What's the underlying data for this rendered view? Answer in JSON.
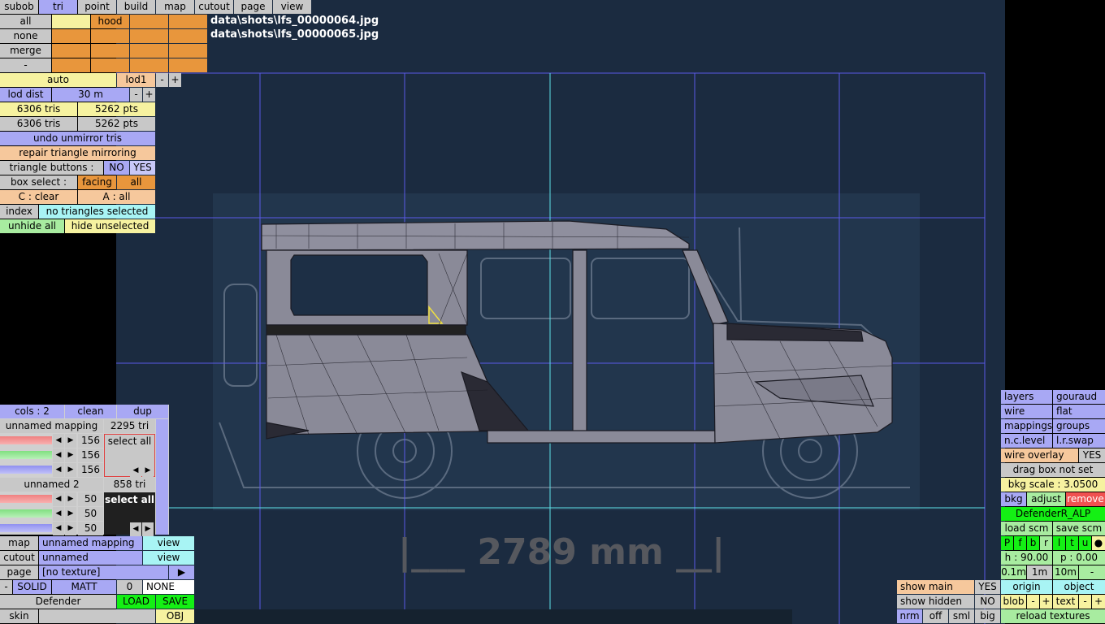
{
  "topbar": {
    "tabs": [
      "subob",
      "tri",
      "point",
      "build",
      "map",
      "cutout",
      "page",
      "view"
    ],
    "active": "tri"
  },
  "subob": {
    "all": "all",
    "none": "none",
    "merge": "merge",
    "minus": "-",
    "hood": "hood"
  },
  "screenshots": [
    "data\\shots\\lfs_00000064.jpg",
    "data\\shots\\lfs_00000065.jpg"
  ],
  "lod": {
    "auto": "auto",
    "lod1": "lod1",
    "minus": "-",
    "plus": "+",
    "dist_label": "lod dist",
    "dist_value": "30 m",
    "dist_minus": "-",
    "dist_plus": "+"
  },
  "counts": {
    "tris1": "6306 tris",
    "pts1": "5262 pts",
    "tris2": "6306 tris",
    "pts2": "5262 pts"
  },
  "tri_panel": {
    "undo_unmirror": "undo unmirror tris",
    "repair_mirroring": "repair triangle mirroring",
    "triangle_buttons": "triangle buttons :",
    "no": "NO",
    "yes": "YES",
    "box_select": "box select :",
    "facing": "facing",
    "all": "all",
    "c_clear": "C : clear",
    "a_all": "A : all",
    "index": "index",
    "selection_status": "no triangles selected",
    "unhide_all": "unhide all",
    "hide_unselected": "hide unselected"
  },
  "mapping_panel": {
    "cols": "cols : 2",
    "clean": "clean",
    "dup": "dup",
    "map1_name": "unnamed mapping",
    "map1_tris": "2295 tri",
    "map1_values": [
      "156",
      "156",
      "156"
    ],
    "map1_select_all": "select all",
    "map2_name": "unnamed 2",
    "map2_tris": "858 tri",
    "map2_values": [
      "50",
      "50",
      "50"
    ],
    "map2_select_all": "select all",
    "map_label": "map",
    "map_value": "unnamed mapping",
    "map_view": "view",
    "cutout_label": "cutout",
    "cutout_value": "unnamed",
    "cutout_view": "view",
    "page_label": "page",
    "page_value": "[no texture]",
    "page_arrow": "▶",
    "minus": "-",
    "solid": "SOLID",
    "matt": "MATT",
    "zero": "0",
    "none": "NONE",
    "object_name": "Defender",
    "load": "LOAD",
    "save": "SAVE",
    "skin": "skin",
    "obj": "OBJ"
  },
  "viewport": {
    "dimension": "|___ 2789 mm __|"
  },
  "right_panel": {
    "layers": "layers",
    "gouraud": "gouraud",
    "wire": "wire",
    "flat": "flat",
    "mappings": "mappings",
    "groups": "groups",
    "nc_level": "n.c.level",
    "lr_swap": "l.r.swap",
    "wire_overlay": "wire overlay",
    "wire_overlay_value": "YES",
    "drag_box": "drag box not set",
    "bkg_scale": "bkg scale : 3.0500",
    "bkg": "bkg",
    "adjust": "adjust",
    "remove": "remove",
    "bkg_name": "DefenderR_ALP",
    "load_scm": "load scm",
    "save_scm": "save scm",
    "views": [
      "P",
      "f",
      "b",
      "r",
      "l",
      "t",
      "u",
      "●"
    ],
    "h": "h : 90.00",
    "p": "p : 0.00",
    "grid": [
      "0.1m",
      "1m",
      "10m",
      "-"
    ],
    "origin": "origin",
    "object": "object",
    "blob": "blob",
    "blob_minus": "-",
    "blob_plus": "+",
    "text": "text",
    "text_minus": "-",
    "text_plus": "+",
    "reload_textures": "reload textures"
  },
  "bottom_panel": {
    "show_main": "show main",
    "show_main_value": "YES",
    "show_hidden": "show hidden",
    "show_hidden_value": "NO",
    "sizes": [
      "nrm",
      "off",
      "sml",
      "big"
    ]
  },
  "colors": {
    "viewport_bg": "#1b2b40",
    "grid_blue": "#5a5ae6",
    "grid_cyan": "#5ee0e8",
    "mesh_fill": "#8a8a9a",
    "mesh_dark": "#252530"
  }
}
